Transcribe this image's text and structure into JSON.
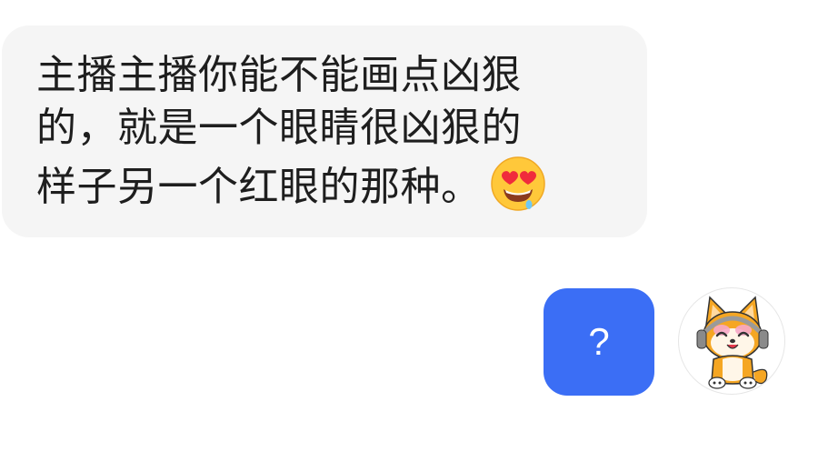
{
  "incoming_message": {
    "lines": [
      "主播主播你能不能画点凶狠",
      "的，就是一个眼睛很凶狠的",
      "样子另一个红眼的那种。"
    ],
    "emoji": "star-struck-heart-eyes-emoji"
  },
  "outgoing_message": {
    "text": "?"
  },
  "avatar": {
    "icon": "shiba-dog-avatar"
  },
  "colors": {
    "incoming_bubble": "#f5f5f5",
    "outgoing_bubble": "#3b6ef5",
    "text_dark": "#1e1e1e",
    "text_light": "#ffffff"
  }
}
